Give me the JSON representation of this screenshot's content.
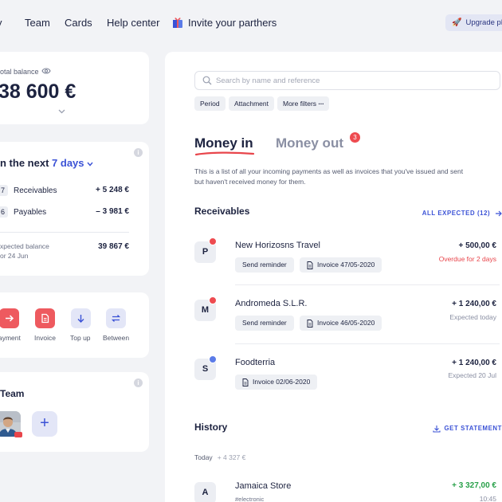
{
  "nav": {
    "items": [
      "y",
      "Team",
      "Cards",
      "Help center"
    ],
    "invite": "Invite your parthers",
    "upgrade": "Upgrade plan"
  },
  "balance": {
    "label": "otal balance",
    "value": "38 600 €"
  },
  "next_days": {
    "title_prefix": "n the next",
    "title_accent": "7 days",
    "rows": [
      {
        "count": "7",
        "label": "Receivables",
        "value": "+ 5 248 €"
      },
      {
        "count": "6",
        "label": "Payables",
        "value": "– 3 981 €"
      }
    ],
    "expected_label_line1": "xpected balance",
    "expected_label_line2": "or 24 Jun",
    "expected_value": "39 867 €"
  },
  "actions": [
    {
      "label": "ayment",
      "color": "#ee5a5f",
      "icon": "arrow-right-icon"
    },
    {
      "label": "Invoice",
      "color": "#ee5a5f",
      "icon": "document-icon"
    },
    {
      "label": "Top up",
      "color": "#e3e6f7",
      "icon": "arrow-down-icon"
    },
    {
      "label": "Between",
      "color": "#e3e6f7",
      "icon": "transfer-icon"
    }
  ],
  "team": {
    "title": "Team",
    "add": "+"
  },
  "search": {
    "placeholder": "Search by name and reference"
  },
  "filters": [
    "Period",
    "Attachment",
    "More filters"
  ],
  "tabs": {
    "money_in": "Money in",
    "money_out": "Money out",
    "money_out_badge": "3"
  },
  "description": "This is a list of all your incoming payments as well as invoices that you've issued and sent but haven't received money for them.",
  "receivables": {
    "title": "Receivables",
    "link": "ALL EXPECTED (12)",
    "items": [
      {
        "initial": "P",
        "name": "New Horizosns Travel",
        "reminder": "Send reminder",
        "invoice": "Invoice 47/05-2020",
        "amount": "+ 500,00 €",
        "status": "Overdue for 2 days",
        "status_color": "#e8454b",
        "dot_color": "#ee4b50"
      },
      {
        "initial": "M",
        "name": "Andromeda S.L.R.",
        "reminder": "Send reminder",
        "invoice": "Invoice 46/05-2020",
        "amount": "+ 1 240,00 €",
        "status": "Expected today",
        "status_color": "#8a8fa3",
        "dot_color": "#ee4b50"
      },
      {
        "initial": "S",
        "name": "Foodterria",
        "invoice": "Invoice 02/06-2020",
        "amount": "+ 1 240,00 €",
        "status": "Expected 20 Jul",
        "status_color": "#8a8fa3",
        "dot_color": "#5b7be8"
      }
    ]
  },
  "history": {
    "title": "History",
    "link": "GET STATEMENT",
    "today_label": "Today",
    "today_sum": "+ 4 327 €",
    "items": [
      {
        "initial": "A",
        "name": "Jamaica Store",
        "tag": "#electronic",
        "amount": "+ 3 327,00 €",
        "time": "10:45"
      }
    ]
  },
  "colors": {
    "accent": "#3b52d6",
    "danger": "#ee4b50",
    "positive": "#2aa14b"
  }
}
